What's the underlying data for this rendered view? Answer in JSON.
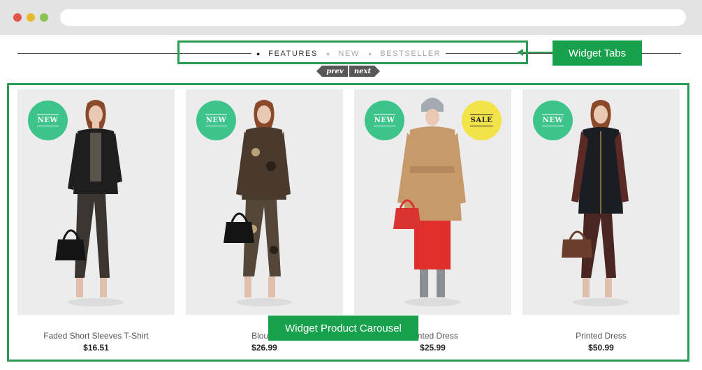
{
  "tabs": {
    "items": [
      {
        "label": "FEATURES",
        "active": true
      },
      {
        "label": "NEW",
        "active": false
      },
      {
        "label": "BESTSELLER",
        "active": false
      }
    ]
  },
  "pager": {
    "prev": "prev",
    "next": "next"
  },
  "callouts": {
    "tabs": "Widget Tabs",
    "carousel": "Widget Product Carousel"
  },
  "products": [
    {
      "name": "Faded Short Sleeves T-Shirt",
      "price": "$16.51",
      "badge": "NEW"
    },
    {
      "name": "Blouse",
      "price": "$26.99",
      "badge": "NEW"
    },
    {
      "name": "Printed Dress",
      "price": "$25.99",
      "badge": "NEW",
      "badge2": "SALE"
    },
    {
      "name": "Printed Dress",
      "price": "$50.99",
      "badge": "NEW"
    }
  ],
  "colors": {
    "accent_green": "#18a14c",
    "badge_new": "#3dc48a",
    "badge_sale": "#f2e34a"
  }
}
